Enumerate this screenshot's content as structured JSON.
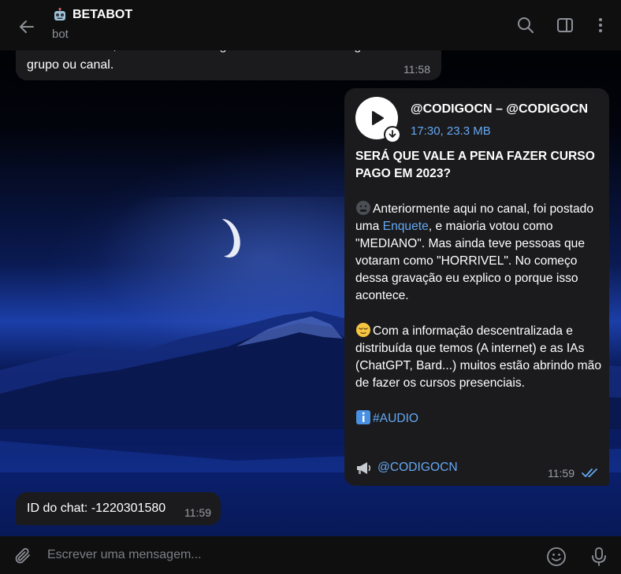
{
  "header": {
    "title": "BETABOT",
    "subtitle": "bot",
    "icons": [
      "back-arrow-icon",
      "robot-emoji-icon",
      "search-icon",
      "sidebar-toggle-icon",
      "more-vertical-icon"
    ]
  },
  "messages": {
    "first": {
      "partial_line": "Para usar o bot, envie uma mensagem encaminhada de algum",
      "text": "grupo ou canal.",
      "time": "11:58"
    },
    "audio": {
      "title": "@CODIGOCN – @CODIGOCN",
      "meta": "17:30, 23.3 MB",
      "heading": "SERÁ QUE VALE A PENA FAZER CURSO PAGO EM 2023?",
      "p1_before": "Anteriormente aqui no canal, foi postado uma ",
      "p1_link": "Enquete",
      "p1_after": ", e maioria votou como \"MEDIANO\". Mas ainda teve pessoas que votaram como \"HORRIVEL\". No começo dessa gravação eu explico o porque isso acontece.",
      "p2": "Com a informação descentralizada e distribuída que temos (A internet) e as IAs (ChatGPT, Bard...) muitos estão abrindo mão de fazer os cursos presenciais.",
      "hashtag": "#AUDIO",
      "channel_link": "@CODIGOCN",
      "time": "11:59"
    },
    "chat_id": {
      "text": "ID do chat: -1220301580",
      "time": "11:59"
    }
  },
  "input": {
    "placeholder": "Escrever uma mensagem..."
  },
  "colors": {
    "header_bg": "#0f0f10",
    "bubble_bg": "#1b1b1d",
    "accent": "#64a8f2",
    "secondary_text": "#9a9ea3"
  }
}
